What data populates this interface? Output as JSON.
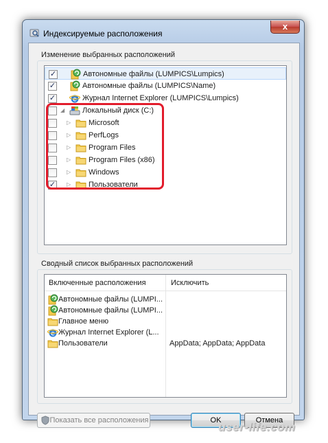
{
  "window": {
    "title": "Индексируемые расположения",
    "close_glyph": "x"
  },
  "top_group": {
    "label": "Изменение выбранных расположений",
    "tree": [
      {
        "label": "Автономные файлы (LUMPICS\\Lumpics)",
        "checked": true,
        "icon": "offline-files-icon",
        "selected": true
      },
      {
        "label": "Автономные файлы (LUMPICS\\Name)",
        "checked": true,
        "icon": "offline-files-icon"
      },
      {
        "label": "Журнал Internet Explorer (LUMPICS\\Lumpics)",
        "checked": true,
        "icon": "ie-icon"
      },
      {
        "label": "Локальный диск (C:)",
        "checked": false,
        "icon": "drive-icon",
        "expanded": true
      },
      {
        "label": "Microsoft",
        "checked": false,
        "icon": "folder-icon"
      },
      {
        "label": "PerfLogs",
        "checked": false,
        "icon": "folder-icon"
      },
      {
        "label": "Program Files",
        "checked": false,
        "icon": "folder-icon"
      },
      {
        "label": "Program Files (x86)",
        "checked": false,
        "icon": "folder-icon"
      },
      {
        "label": "Windows",
        "checked": false,
        "icon": "folder-icon"
      },
      {
        "label": "Пользователи",
        "checked": true,
        "icon": "folder-icon"
      }
    ],
    "check_glyph": "✓",
    "expand_glyph": "▷",
    "expanded_glyph": "◢"
  },
  "bottom_group": {
    "label": "Сводный список выбранных расположений",
    "columns": [
      "Включенные расположения",
      "Исключить"
    ],
    "rows": [
      {
        "name": "Автономные файлы (LUMPI...",
        "exclude": "",
        "icon": "offline-files-icon"
      },
      {
        "name": "Автономные файлы (LUMPI...",
        "exclude": "",
        "icon": "offline-files-icon"
      },
      {
        "name": "Главное меню",
        "exclude": "",
        "icon": "folder-icon"
      },
      {
        "name": "Журнал Internet Explorer (L...",
        "exclude": "",
        "icon": "ie-icon"
      },
      {
        "name": "Пользователи",
        "exclude": "AppData; AppData; AppData",
        "icon": "folder-icon"
      }
    ]
  },
  "buttons": {
    "show_all": "Показать все расположения",
    "ok": "OK",
    "cancel": "Отмена"
  },
  "watermark": "user-life.com",
  "colors": {
    "highlight": "#e21c2c",
    "selection": "#e8f1fb",
    "folder": "#f2c94c"
  }
}
